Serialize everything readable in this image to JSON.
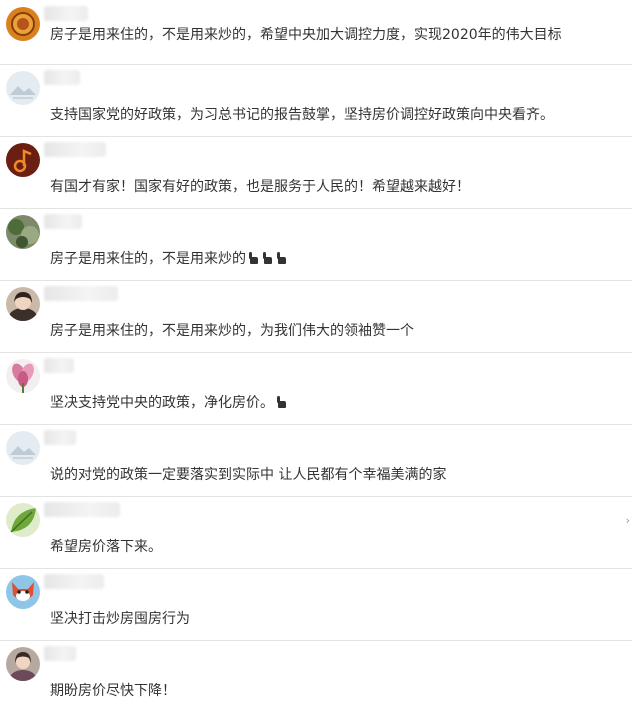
{
  "comments": [
    {
      "text": "房子是用来住的，不是用来炒的，希望中央加大调控力度，实现2020年的伟大目标",
      "hands": 0,
      "avatar_icon": "seal-avatar-icon"
    },
    {
      "text": "支持国家党的好政策，为习总书记的报告鼓掌，坚持房价调控好政策向中央看齐。",
      "hands": 0,
      "avatar_icon": "default-landscape-avatar-icon"
    },
    {
      "text": "有国才有家！国家有好的政策，也是服务于人民的！希望越来越好！",
      "hands": 0,
      "avatar_icon": "music-note-avatar-icon"
    },
    {
      "text": "房子是用来住的，不是用来炒的",
      "hands": 3,
      "avatar_icon": "plant-photo-avatar-icon"
    },
    {
      "text": "房子是用来住的，不是用来炒的，为我们伟大的领袖赞一个",
      "hands": 0,
      "avatar_icon": "woman-photo-avatar-icon"
    },
    {
      "text": "坚决支持党中央的政策，净化房价。",
      "hands": 1,
      "avatar_icon": "flower-avatar-icon"
    },
    {
      "text": "说的对党的政策一定要落实到实际中  让人民都有个幸福美满的家",
      "hands": 0,
      "avatar_icon": "default-landscape-avatar-icon"
    },
    {
      "text": "希望房价落下来。",
      "hands": 0,
      "avatar_icon": "leaf-avatar-icon"
    },
    {
      "text": "坚决打击炒房囤房行为",
      "hands": 0,
      "avatar_icon": "cartoon-fox-avatar-icon"
    },
    {
      "text": "期盼房价尽快下降！",
      "hands": 0,
      "avatar_icon": "woman-photo-avatar-icon"
    }
  ],
  "colors": {
    "text": "#333333",
    "divider": "#e3e3e3"
  }
}
